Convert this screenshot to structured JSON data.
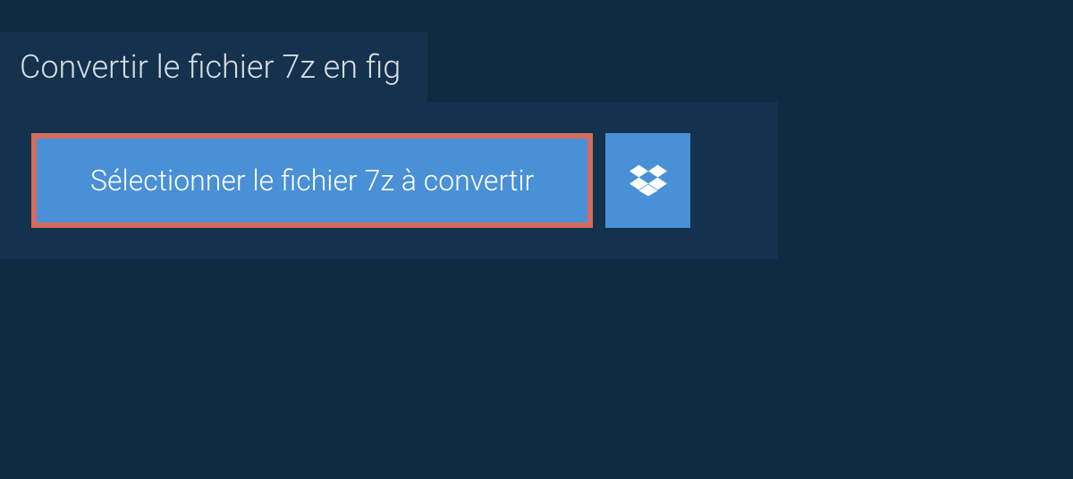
{
  "tab": {
    "title": "Convertir le fichier 7z en fig"
  },
  "actions": {
    "select_file_label": "Sélectionner le fichier 7z à convertir"
  },
  "colors": {
    "background": "#0e2a42",
    "panel": "#14324d",
    "button": "#4990d6",
    "highlight_border": "#d56a5f"
  }
}
